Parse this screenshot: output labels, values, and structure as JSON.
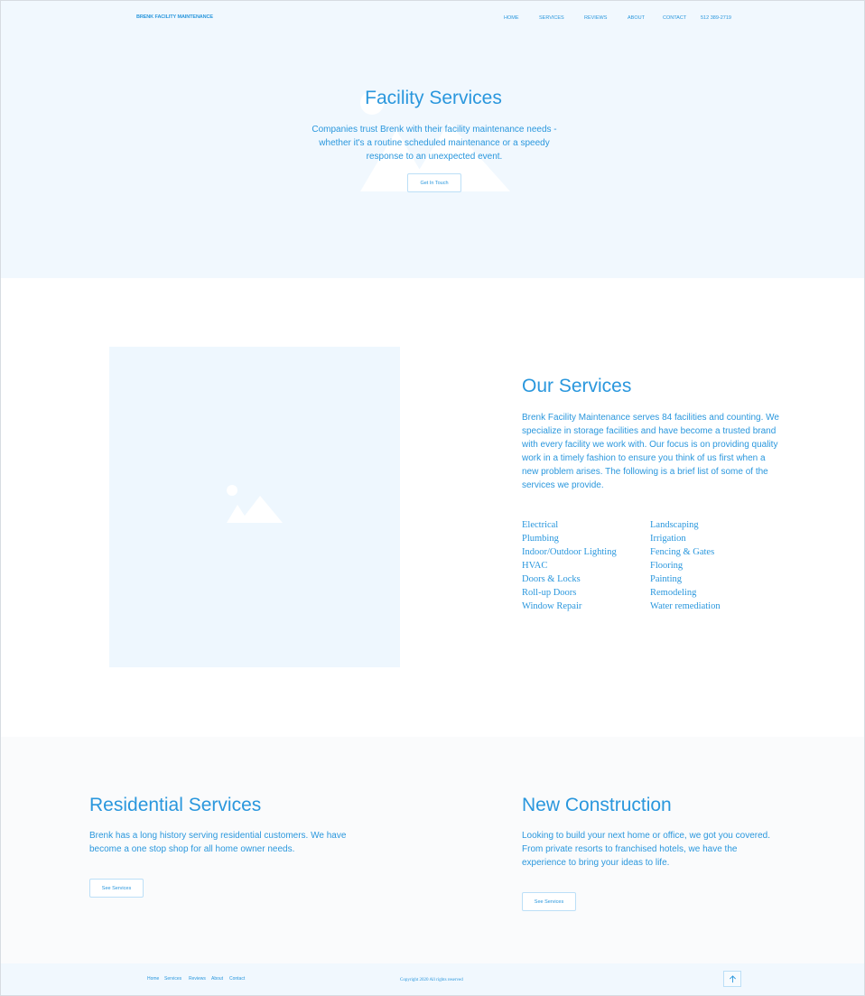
{
  "colors": {
    "accent": "#2a97dd",
    "hero_bg": "#f1f8fe",
    "placeholder_bg": "#eef7fe",
    "section_alt_bg": "#fafbfc",
    "button_border": "#bcdff7"
  },
  "header": {
    "brand": "BRENK FACILITY MAINTENANCE",
    "nav": [
      "HOME",
      "SERVICES",
      "REVIEWS",
      "ABOUT",
      "CONTACT",
      "512 389-2719"
    ]
  },
  "hero": {
    "title": "Facility Services",
    "text": "Companies trust Brenk with their facility maintenance needs - whether it's a routine scheduled maintenance or a speedy response to an unexpected event.",
    "button": "Get In Touch",
    "background_icon": "image-placeholder-icon"
  },
  "services": {
    "image_icon": "image-placeholder-icon",
    "title": "Our Services",
    "text": "Brenk Facility Maintenance serves 84 facilities and counting. We specialize in storage facilities and have become a trusted brand with every facility we work with. Our focus is on providing quality work in a timely fashion to ensure you think of us first when a new problem arises. The following is a brief list of some of the services we provide.",
    "list_left": [
      "Electrical",
      "Plumbing",
      "Indoor/Outdoor Lighting",
      "HVAC",
      "Doors & Locks",
      "Roll-up Doors",
      "Window Repair"
    ],
    "list_right": [
      "Landscaping",
      "Irrigation",
      "Fencing & Gates",
      "Flooring",
      "Painting",
      "Remodeling",
      "Water remediation"
    ]
  },
  "residential": {
    "title": "Residential Services",
    "text": "Brenk has a long history serving residential customers. We have become a one stop shop for all home owner needs.",
    "button": "See Services"
  },
  "new_construction": {
    "title": "New Construction",
    "text": "Looking to build your next home or office, we got you covered. From private resorts to franchised hotels, we have the experience to bring your ideas to life.",
    "button": "See Services"
  },
  "footer": {
    "links": [
      "Home",
      "Services",
      "Reviews",
      "About",
      "Contact"
    ],
    "copyright": "Copyright 2020 All rights reserved",
    "top_icon": "arrow-up-icon"
  }
}
